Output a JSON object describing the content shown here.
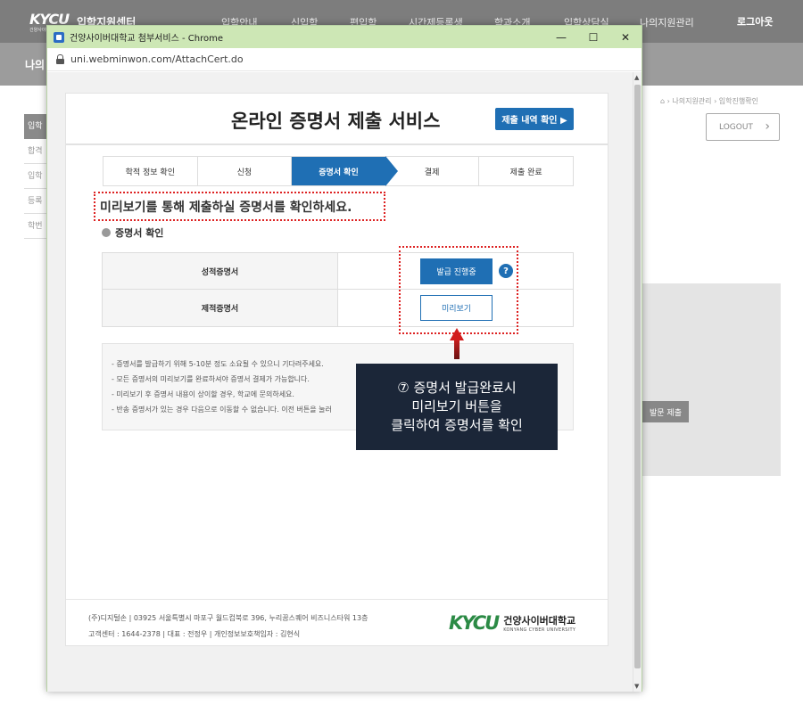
{
  "site": {
    "logo": "KYCU",
    "logo_sub": "건양사이버대학교",
    "title": "입학지원센터",
    "nav": [
      "입학안내",
      "신입학",
      "편입학",
      "시간제등록생",
      "학과소개",
      "입학상담실",
      "나의지원관리"
    ],
    "login": "로그아웃",
    "subbar_title": "나의",
    "left_menu": [
      "입학",
      "합격",
      "입학",
      "등록",
      "학번"
    ],
    "breadcrumb": "⌂ › 나의지원관리 › 입학진행확인",
    "logout_button": "LOGOUT",
    "panel_button": "발문 제출"
  },
  "window": {
    "title": "건양사이버대학교 첨부서비스 - Chrome",
    "minimize": "—",
    "maximize": "☐",
    "close": "✕",
    "url": "uni.webminwon.com/AttachCert.do"
  },
  "page": {
    "title": "온라인 증명서 제출 서비스",
    "history_button": "제출 내역 확인 ▶",
    "steps": [
      {
        "label": "학적 정보 확인",
        "active": false
      },
      {
        "label": "신청",
        "active": false
      },
      {
        "label": "증명서 확인",
        "active": true
      },
      {
        "label": "결제",
        "active": false
      },
      {
        "label": "제출 완료",
        "active": false
      }
    ],
    "notice": "미리보기를 통해 제출하실 증명서를 확인하세요.",
    "section_title": "증명서 확인",
    "certificates": [
      {
        "name": "성적증명서",
        "button": "발급 진행중",
        "help": "?"
      },
      {
        "name": "제적증명서",
        "button": "미리보기"
      }
    ],
    "info_lines": [
      "- 증명서를 발급하기 위해 5-10분 정도 소요될 수 있으니 기다려주세요.",
      "- 모든 증명서의 미리보기를 완료하셔야 증명서 결제가 가능합니다.",
      "- 미리보기 후 증명서 내용이 상이할 경우, 학교에 문의하세요.",
      "- 반송 증명서가 있는 경우 다음으로 이동할 수 없습니다. 이전 버튼을 눌러"
    ],
    "callout_lines": [
      "⑦ 증명서 발급완료시",
      "미리보기 버튼을",
      "클릭하여  증명서를 확인"
    ],
    "footer": {
      "line1": "(주)디지털손 | 03925 서울특별시 마포구 월드컵북로 396, 누리꿈스퀘어 비즈니스타워 13층",
      "line2": "고객센터 : 1644-2378 | 대표 : 전정우 | 개인정보보호책임자 : 김현식",
      "logo_mark": "KYCU",
      "logo_kor": "건양사이버대학교",
      "logo_eng": "KONYANG CYBER UNIVERSITY"
    }
  },
  "colors": {
    "accent": "#1f6fb4",
    "highlight": "#dd2222",
    "titlebar": "#cde7b5",
    "callout": "#1b2638"
  }
}
